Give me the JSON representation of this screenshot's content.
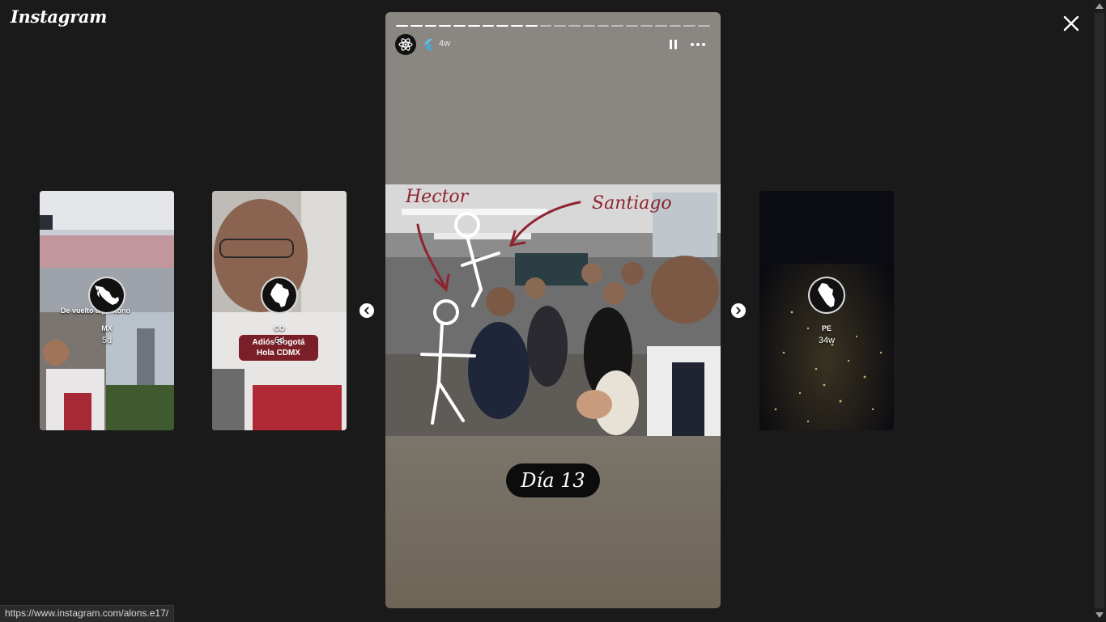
{
  "app": {
    "logo_text": "Instagram"
  },
  "close_button": {
    "label": "Close"
  },
  "thumbnails": [
    {
      "username": "MX",
      "age": "5d",
      "caption": "De vuelto a pantono"
    },
    {
      "username": "CO",
      "age": "6d",
      "sticker_line1": "Adiós Bogotá",
      "sticker_line2": "Hola CDMX"
    },
    {
      "username": "PE",
      "age": "34w"
    }
  ],
  "story": {
    "time": "4w",
    "segments_total": 22,
    "segments_done": 10,
    "photo_labels": {
      "left_name": "Hector",
      "right_name": "Santiago"
    },
    "sticker_text": "Día 13"
  },
  "status_bar": {
    "url": "https://www.instagram.com/alons.e17/"
  },
  "colors": {
    "background": "#1a1a1a",
    "sticker_red": "#7a1e28"
  }
}
